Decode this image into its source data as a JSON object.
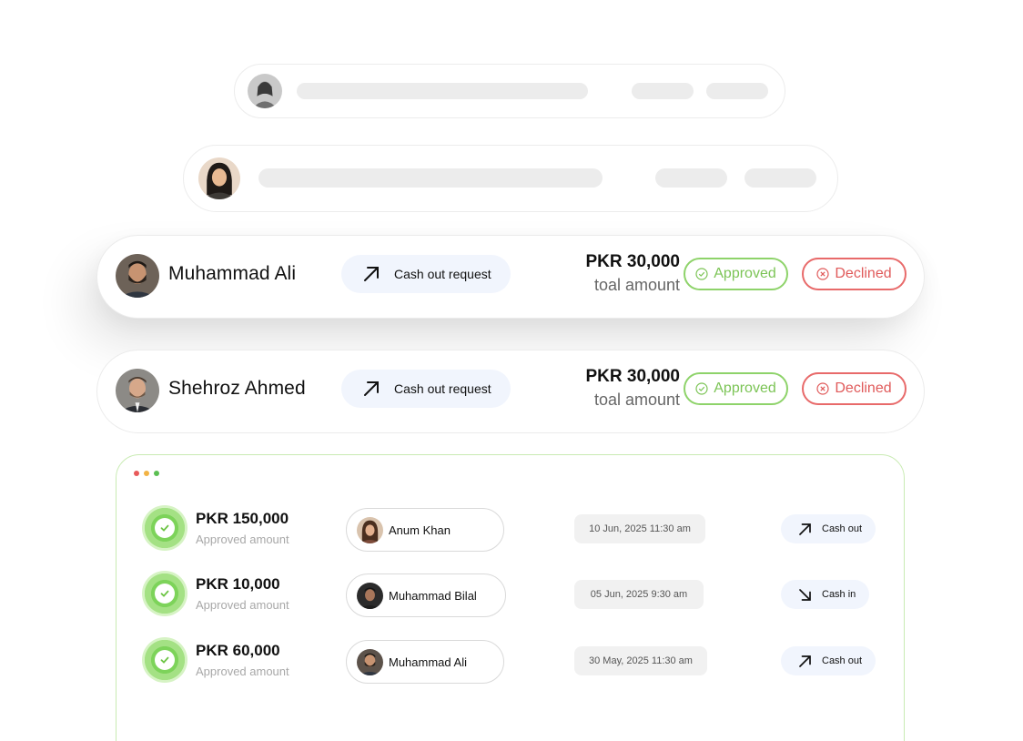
{
  "colors": {
    "approved": "#7cc456",
    "declined": "#e05a5a",
    "chip_bg": "#f1f5fd",
    "panel_border": "#c9ebb3",
    "window_dots": [
      "#e85a5a",
      "#f2b344",
      "#5bbf52"
    ]
  },
  "requests": [
    {
      "name": "Muhammad Ali",
      "type_label": "Cash out request",
      "type_icon": "arrow-up-right-icon",
      "amount": "PKR 30,000",
      "amount_sub": "toal amount",
      "approve_label": "Approved",
      "decline_label": "Declined"
    },
    {
      "name": "Shehroz Ahmed",
      "type_label": "Cash out request",
      "type_icon": "arrow-up-right-icon",
      "amount": "PKR 30,000",
      "amount_sub": "toal amount",
      "approve_label": "Approved",
      "decline_label": "Declined"
    }
  ],
  "transactions": [
    {
      "amount": "PKR 150,000",
      "status": "Approved amount",
      "person": "Anum Khan",
      "date": "10 Jun, 2025  11:30 am",
      "flow": "Cash out",
      "flow_icon": "arrow-up-right-icon"
    },
    {
      "amount": "PKR 10,000",
      "status": "Approved amount",
      "person": "Muhammad Bilal",
      "date": "05 Jun, 2025  9:30 am",
      "flow": "Cash in",
      "flow_icon": "arrow-down-right-icon"
    },
    {
      "amount": "PKR 60,000",
      "status": "Approved amount",
      "person": "Muhammad Ali",
      "date": "30 May, 2025  11:30 am",
      "flow": "Cash out",
      "flow_icon": "arrow-up-right-icon"
    }
  ]
}
